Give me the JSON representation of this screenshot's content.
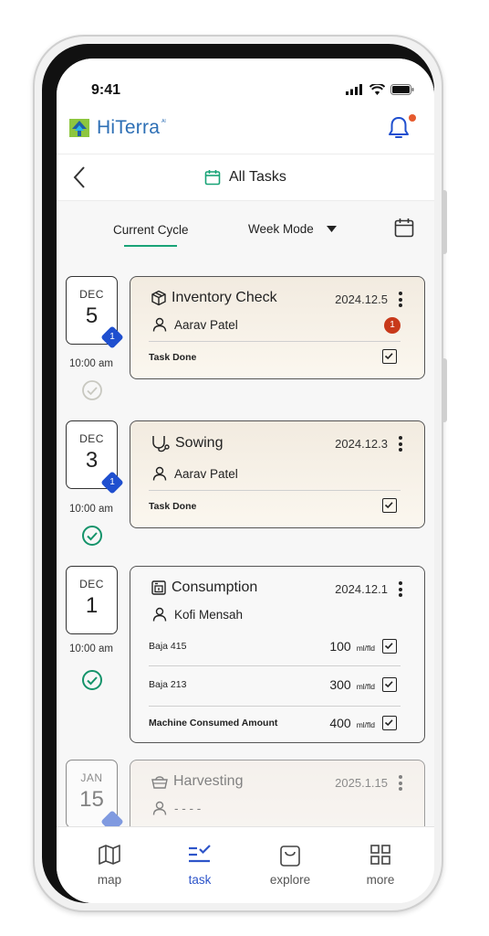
{
  "status_bar": {
    "time": "9:41"
  },
  "header": {
    "app_name": "HiTerra",
    "brand_mark": "AI",
    "accent_color": "#19a377",
    "notification_dot_color": "#e65a2e"
  },
  "title_bar": {
    "title": "All Tasks"
  },
  "modes": {
    "current_tab": "Current Cycle",
    "week_mode": "Week Mode"
  },
  "tasks": [
    {
      "month": "DEC",
      "day": "5",
      "badge": "1",
      "time": "10:00 am",
      "done": false,
      "title": "Inventory Check",
      "date": "2024.12.5",
      "person": "Aarav Patel",
      "count": "1",
      "footer_label": "Task Done",
      "icon": "package-icon"
    },
    {
      "month": "DEC",
      "day": "3",
      "badge": "1",
      "time": "10:00 am",
      "done": true,
      "title": "Sowing",
      "date": "2024.12.3",
      "person": "Aarav Patel",
      "footer_label": "Task Done",
      "icon": "sowing-icon"
    },
    {
      "month": "DEC",
      "day": "1",
      "time": "10:00 am",
      "done": true,
      "title": "Consumption",
      "date": "2024.12.1",
      "person": "Kofi Mensah",
      "icon": "consumption-icon",
      "rows": [
        {
          "label": "Baja 415",
          "value": "100",
          "unit": "ml/fld"
        },
        {
          "label": "Baja 213",
          "value": "300",
          "unit": "ml/fld"
        },
        {
          "label": "Machine Consumed Amount",
          "value": "400",
          "unit": "ml/fld"
        }
      ]
    },
    {
      "month": "JAN",
      "day": "15",
      "title": "Harvesting",
      "date": "2025.1.15",
      "person": "- - - -",
      "icon": "harvest-basket-icon"
    }
  ],
  "bottom_nav": {
    "items": [
      {
        "label": "map",
        "icon": "map-icon"
      },
      {
        "label": "task",
        "icon": "task-list-icon",
        "active": true
      },
      {
        "label": "explore",
        "icon": "shopping-bag-icon"
      },
      {
        "label": "more",
        "icon": "grid-icon"
      }
    ]
  }
}
